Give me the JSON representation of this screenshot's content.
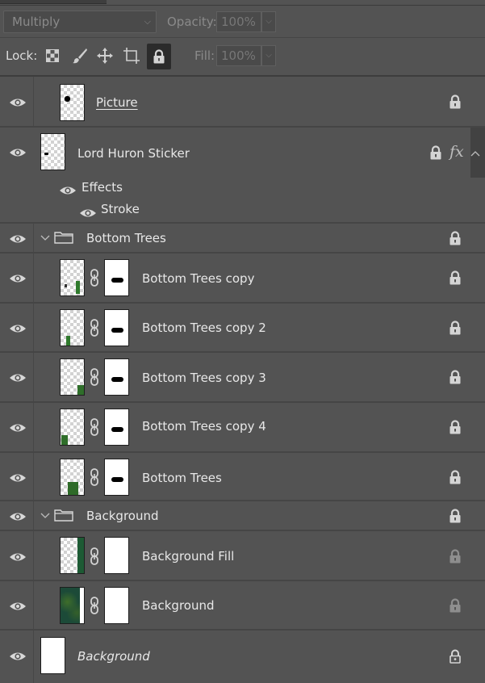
{
  "toolbar": {
    "blend_mode": "Multiply",
    "opacity_label": "Opacity:",
    "opacity_value": "100%",
    "lock_label": "Lock:",
    "fill_label": "Fill:",
    "fill_value": "100%"
  },
  "layers": [
    {
      "name": "Picture",
      "locked": true
    },
    {
      "name": "Lord Huron Sticker",
      "locked": true,
      "fx": "fx",
      "effects_label": "Effects",
      "stroke_label": "Stroke"
    },
    {
      "name": "Bottom Trees",
      "type": "group",
      "expanded": true,
      "locked": true
    },
    {
      "name": "Bottom Trees copy",
      "locked": true
    },
    {
      "name": "Bottom Trees copy 2",
      "locked": true
    },
    {
      "name": "Bottom Trees copy 3",
      "locked": true
    },
    {
      "name": "Bottom Trees copy 4",
      "locked": true
    },
    {
      "name": "Bottom Trees",
      "locked": true
    },
    {
      "name": "Background",
      "type": "group",
      "expanded": true,
      "locked": true
    },
    {
      "name": "Background Fill",
      "locked": true
    },
    {
      "name": "Background",
      "locked": true
    },
    {
      "name": "Background",
      "locked": true,
      "italic": true
    }
  ],
  "icons": {
    "visibility": "eye-icon",
    "lock": "padlock-icon",
    "group": "folder-icon",
    "link": "chain-link-icon"
  },
  "colors": {
    "panel": "#535353",
    "divider": "#454545",
    "text": "#e8e8e8",
    "disabled_text": "#8a8a8a"
  }
}
